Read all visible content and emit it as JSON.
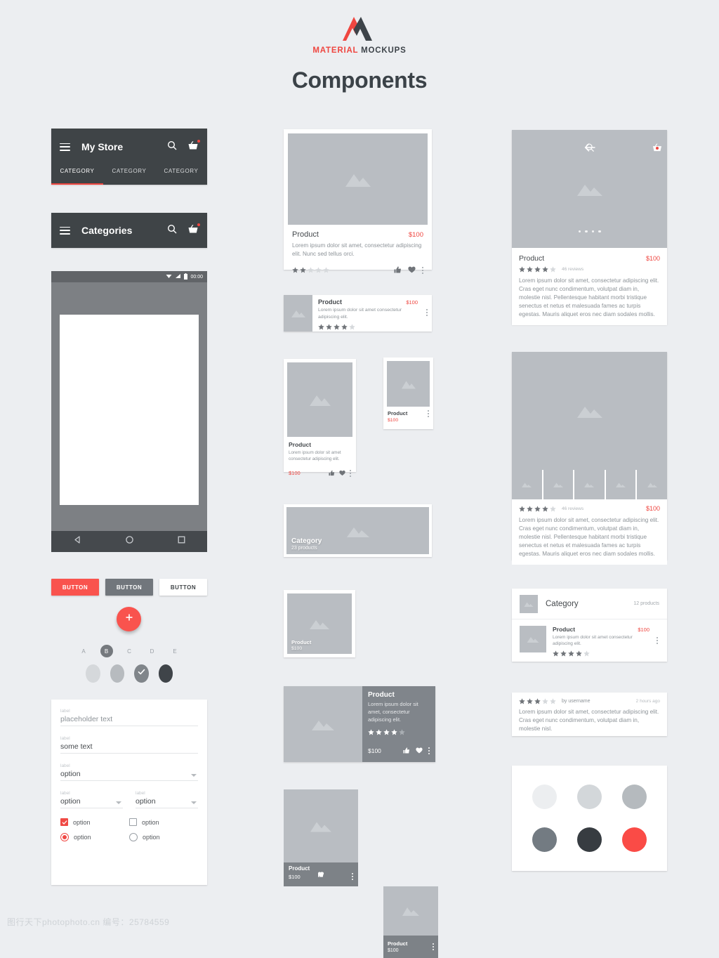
{
  "brand": {
    "name_primary": "MATERIAL",
    "name_secondary": "MOCKUPS",
    "accent": "#ef4640"
  },
  "page": {
    "title": "Components",
    "background": "#eceef1"
  },
  "colors": {
    "accent_red": "#f9534e",
    "dark_appbar": "#3f4447",
    "placeholder_grey": "#b9bdc2",
    "text_dark": "#45494d",
    "text_muted": "#8d9398"
  },
  "left": {
    "appbar_tabs": {
      "title": "My Store",
      "menu_icon": "hamburger-icon",
      "search_icon": "search-icon",
      "cart_icon": "shopping-basket-icon",
      "cart_badge": true,
      "tabs": [
        {
          "label": "CATEGORY",
          "active": true
        },
        {
          "label": "CATEGORY",
          "active": false
        },
        {
          "label": "CATEGORY",
          "active": false
        }
      ]
    },
    "appbar_simple": {
      "title": "Categories",
      "menu_icon": "hamburger-icon",
      "search_icon": "search-icon",
      "cart_icon": "shopping-basket-icon",
      "cart_badge": true
    },
    "phone": {
      "status_time": "00:00",
      "status_icons": [
        "wifi-icon",
        "signal-icon",
        "battery-icon"
      ],
      "nav_icons": [
        "back-triangle-icon",
        "home-circle-icon",
        "recents-square-icon"
      ]
    },
    "buttons": [
      {
        "label": "BUTTON",
        "style": "raised-red"
      },
      {
        "label": "BUTTON",
        "style": "raised-grey"
      },
      {
        "label": "BUTTON",
        "style": "flat"
      }
    ],
    "fab": {
      "icon": "plus-icon",
      "color": "#f9534e"
    },
    "chips": [
      {
        "label": "A",
        "selected": false
      },
      {
        "label": "B",
        "selected": true
      },
      {
        "label": "C",
        "selected": false
      },
      {
        "label": "D",
        "selected": false
      },
      {
        "label": "E",
        "selected": false
      }
    ],
    "avatars": [
      {
        "color": "#d5d8db",
        "checked": false
      },
      {
        "color": "#b7bbbf",
        "checked": false
      },
      {
        "color": "#80858a",
        "checked": true
      },
      {
        "color": "#3f4449",
        "checked": false
      }
    ],
    "form": {
      "fields": [
        {
          "label": "label",
          "value": "placeholder text",
          "type": "placeholder"
        },
        {
          "label": "label",
          "value": "some text",
          "type": "text"
        },
        {
          "label": "label",
          "value": "option",
          "type": "select"
        }
      ],
      "select_pair": [
        {
          "label": "label",
          "value": "option"
        },
        {
          "label": "label",
          "value": "option"
        }
      ],
      "checkboxes": [
        {
          "label": "option",
          "checked": true
        },
        {
          "label": "option",
          "checked": false
        }
      ],
      "radios": [
        {
          "label": "option",
          "checked": true
        },
        {
          "label": "option",
          "checked": false
        }
      ]
    }
  },
  "middle": {
    "card_wide": {
      "title": "Product",
      "price": "$100",
      "description": "Lorem ipsum dolor sit amet, consectetur adipiscing elit. Nunc sed tellus orci.",
      "rating": 2,
      "max_rating": 5,
      "actions": [
        "thumb-up-icon",
        "heart-icon",
        "overflow-menu-icon"
      ]
    },
    "card_list": {
      "title": "Product",
      "price": "$100",
      "description": "Lorem ipsum dolor sit amet consectetur adipiscing elit.",
      "rating": 4,
      "max_rating": 5,
      "actions": [
        "overflow-menu-icon"
      ]
    },
    "card_tall": {
      "title": "Product",
      "description": "Lorem ipsum dolor sit amet consectetur adipiscing elit.",
      "price": "$100",
      "actions": [
        "thumb-up-icon",
        "heart-icon",
        "overflow-menu-icon"
      ]
    },
    "card_mini": {
      "title": "Product",
      "price": "$100",
      "actions": [
        "overflow-menu-icon"
      ]
    },
    "card_category": {
      "title": "Category",
      "subtitle": "23 products"
    },
    "card_square": {
      "title": "Product",
      "price": "$100"
    },
    "card_hero": {
      "title": "Product",
      "description": "Lorem ipsum dolor sit amet, consectetur adipiscing elit.",
      "rating": 4,
      "max_rating": 5,
      "price": "$100",
      "actions": [
        "thumb-up-icon",
        "heart-icon",
        "overflow-menu-icon"
      ]
    },
    "card_vertical": {
      "title": "Product",
      "price": "$100",
      "actions": [
        "thumb-up-icon",
        "heart-icon",
        "overflow-menu-icon"
      ]
    },
    "card_vertical_small": {
      "title": "Product",
      "price": "$100",
      "actions": [
        "overflow-menu-icon"
      ]
    }
  },
  "right": {
    "detail": {
      "back_icon": "arrow-left-icon",
      "search_icon": "search-icon",
      "cart_icon": "shopping-basket-icon",
      "cart_badge": true,
      "pager_dots": 4,
      "title": "Product",
      "price": "$100",
      "rating": 4,
      "max_rating": 5,
      "reviews": "46 reviews",
      "description": "Lorem ipsum dolor sit amet, consectetur adipiscing elit. Cras eget nunc condimentum, volutpat diam in, molestie nisl. Pellentesque habitant morbi tristique senectus et netus et malesuada fames ac turpis egestas. Mauris aliquet eros nec diam sodales mollis."
    },
    "gallery": {
      "thumb_count": 5,
      "rating": 4,
      "max_rating": 5,
      "reviews": "46 reviews",
      "price": "$100",
      "description": "Lorem ipsum dolor sit amet, consectetur adipiscing elit. Cras eget nunc condimentum, volutpat diam in, molestie nisl. Pellentesque habitant morbi tristique senectus et netus et malesuada fames ac turpis egestas. Mauris aliquet eros nec diam sodales mollis."
    },
    "category_list": {
      "header_title": "Category",
      "header_count": "12 products",
      "item": {
        "title": "Product",
        "price": "$100",
        "description": "Lorem ipsum dolor sit amet consectetur adipiscing elit.",
        "rating": 4,
        "max_rating": 5,
        "actions": [
          "overflow-menu-icon"
        ]
      }
    },
    "review": {
      "rating": 3,
      "max_rating": 5,
      "author": "by username",
      "time": "2 hours ago",
      "text": "Lorem ipsum dolor sit amet, consectetur adipiscing elit. Cras eget nunc condimentum, volutpat diam in, molestie nisl."
    },
    "palette": [
      {
        "name": "grey-50",
        "hex": "#eceef0"
      },
      {
        "name": "grey-200",
        "hex": "#d3d7da"
      },
      {
        "name": "grey-400",
        "hex": "#b5babe"
      },
      {
        "name": "blue-grey-400",
        "hex": "#737b82"
      },
      {
        "name": "grey-900",
        "hex": "#373c41"
      },
      {
        "name": "red-accent",
        "hex": "#fa4b46"
      }
    ]
  },
  "watermark": "图行天下photophoto.cn  编号：25784559"
}
